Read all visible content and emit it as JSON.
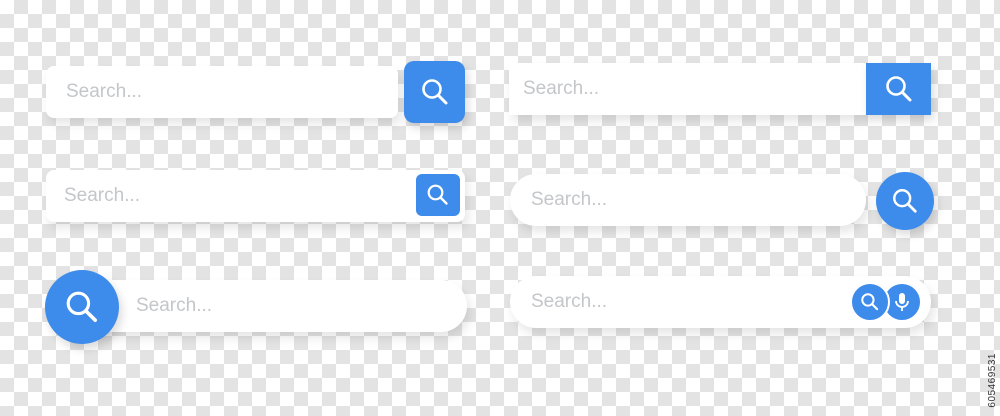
{
  "search_bars": [
    {
      "placeholder": "Search..."
    },
    {
      "placeholder": "Search..."
    },
    {
      "placeholder": "Search..."
    },
    {
      "placeholder": "Search..."
    },
    {
      "placeholder": "Search..."
    },
    {
      "placeholder": "Search..."
    }
  ],
  "icons": {
    "search": "search-icon",
    "microphone": "microphone-icon"
  },
  "colors": {
    "accent": "#3d8bea",
    "field_bg": "#ffffff",
    "placeholder": "#c4c6c9"
  },
  "watermark": "605469531"
}
